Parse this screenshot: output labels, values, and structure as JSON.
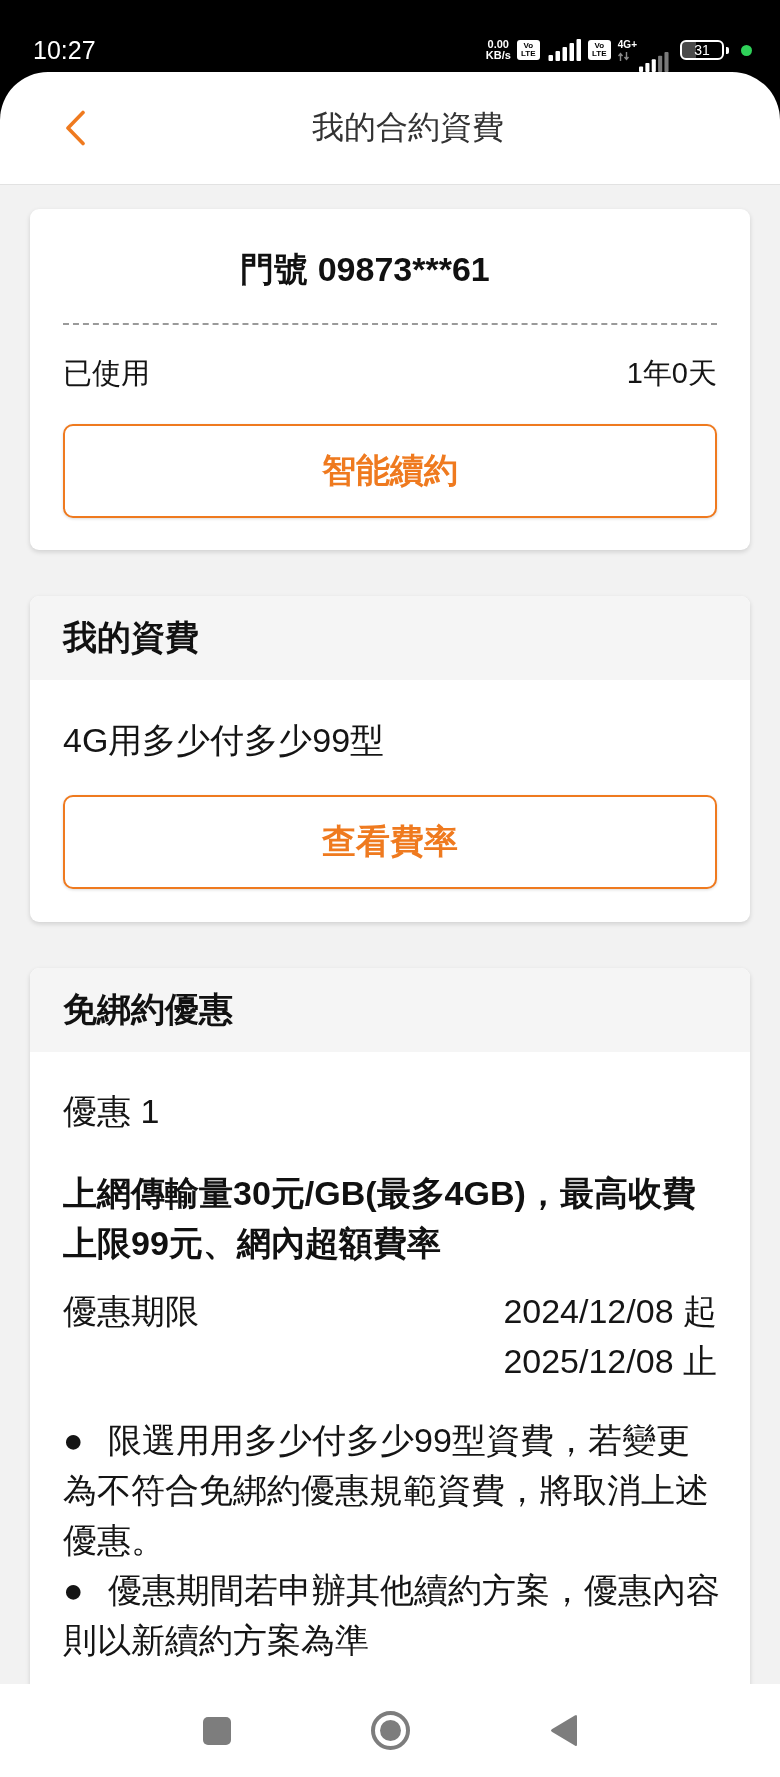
{
  "status_bar": {
    "time": "10:27",
    "net_speed": [
      "0.00",
      "KB/s"
    ],
    "sims": [
      {
        "badge": [
          "Vo",
          "LTE"
        ]
      },
      {
        "badge": [
          "Vo",
          "LTE"
        ],
        "network": "4G+"
      }
    ],
    "battery": "31"
  },
  "header": {
    "title": "我的合約資費"
  },
  "number_card": {
    "title": "門號 09873***61",
    "rows": [
      {
        "label": "已使用",
        "value": "1年0天"
      }
    ],
    "button": "智能續約"
  },
  "plan_card": {
    "heading": "我的資費",
    "plan": "4G用多少付多少99型",
    "button": "查看費率"
  },
  "offer_card": {
    "heading": "免綁約優惠",
    "offers": [
      {
        "label": "優惠 1",
        "title": "上網傳輸量30元/GB(最多4GB)，最高收費上限99元、網內超額費率",
        "period_label": "優惠期限",
        "period": [
          "2024/12/08 起",
          "2025/12/08 止"
        ],
        "notes": [
          "● 限選用用多少付多少99型資費，若變更為不符合免綁約優惠規範資費，將取消上述優惠。",
          "● 優惠期間若申辦其他續約方案，優惠內容則以新續約方案為準"
        ]
      }
    ]
  }
}
